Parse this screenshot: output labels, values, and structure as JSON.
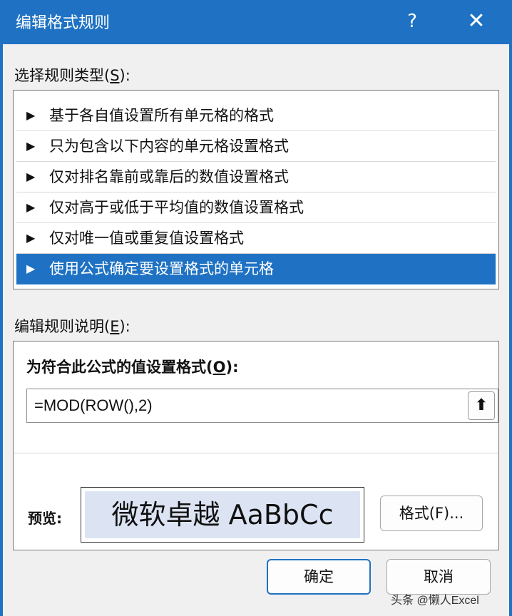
{
  "window": {
    "title": "编辑格式规则",
    "help": "?",
    "close": "✕"
  },
  "rule_type": {
    "label_pre": "选择规则类型(",
    "label_key": "S",
    "label_post": "):",
    "arrow": "▶",
    "items": [
      {
        "label": "基于各自值设置所有单元格的格式"
      },
      {
        "label": "只为包含以下内容的单元格设置格式"
      },
      {
        "label": "仅对排名靠前或靠后的数值设置格式"
      },
      {
        "label": "仅对高于或低于平均值的数值设置格式"
      },
      {
        "label": "仅对唯一值或重复值设置格式"
      },
      {
        "label": "使用公式确定要设置格式的单元格"
      }
    ],
    "selected_index": 5
  },
  "description": {
    "label_pre": "编辑规则说明(",
    "label_key": "E",
    "label_post": "):",
    "formula_title_pre": "为符合此公式的值设置格式(",
    "formula_title_key": "O",
    "formula_title_post": "):",
    "formula_value": "=MOD(ROW(),2)",
    "collapse_icon": "⬆",
    "preview_label": "预览:",
    "preview_text": "微软卓越  AaBbCc",
    "format_button": "格式(F)..."
  },
  "buttons": {
    "ok": "确定",
    "cancel": "取消"
  },
  "watermark": "头条 @懒人Excel",
  "colors": {
    "accent": "#1f72c3",
    "preview_bg": "#dce4f3"
  }
}
